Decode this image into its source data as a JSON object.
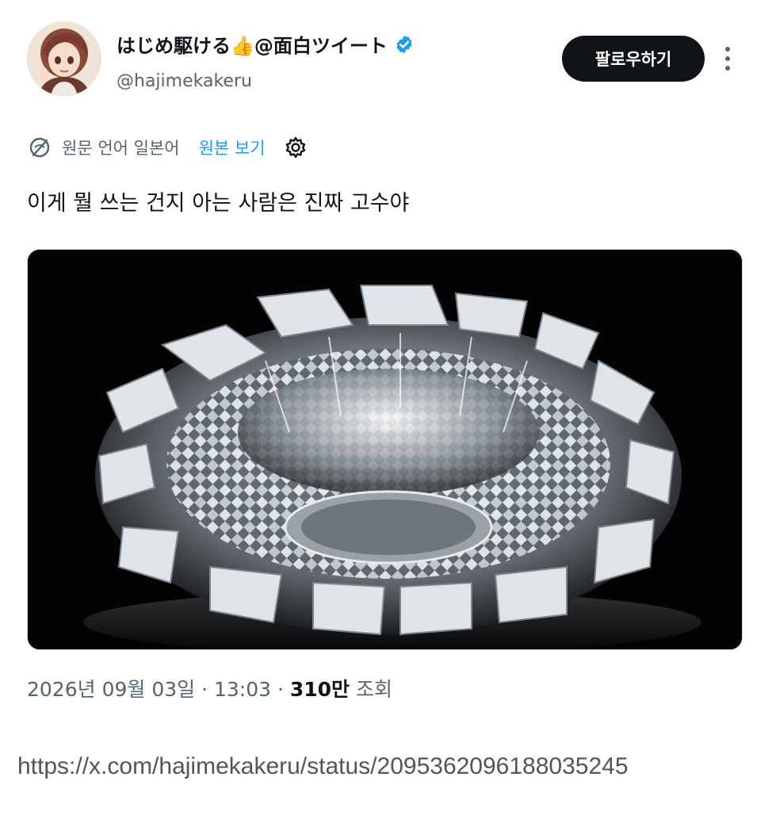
{
  "author": {
    "display_name": "はじめ駆ける👍@面白ツイート",
    "handle": "@hajimekakeru",
    "verified": true,
    "avatar_icon": "anime-character-avatar"
  },
  "actions": {
    "follow_label": "팔로우하기",
    "more_icon": "more-vertical-icon"
  },
  "translation": {
    "original_language_label": "원문 언어 일본어",
    "show_original_label": "원본 보기",
    "translate_icon": "translate-icon",
    "settings_icon": "settings-gear-icon"
  },
  "tweet": {
    "text": "이게 뭘 쓰는 건지 아는 사람은 진짜 고수야"
  },
  "media": {
    "description_icon": "crystal-glass-ashtray-photo"
  },
  "meta": {
    "date": "2026년 09월 03일",
    "separator": " · ",
    "time": "13:03",
    "dot": " · ",
    "views_count": "310만",
    "views_label": " 조회"
  },
  "source_url": "https://x.com/hajimekakeru/status/2095362096188035245",
  "colors": {
    "accent_blue": "#1d9bf0",
    "text_primary": "#0f1419",
    "text_secondary": "#536471",
    "button_dark": "#0f1419"
  }
}
